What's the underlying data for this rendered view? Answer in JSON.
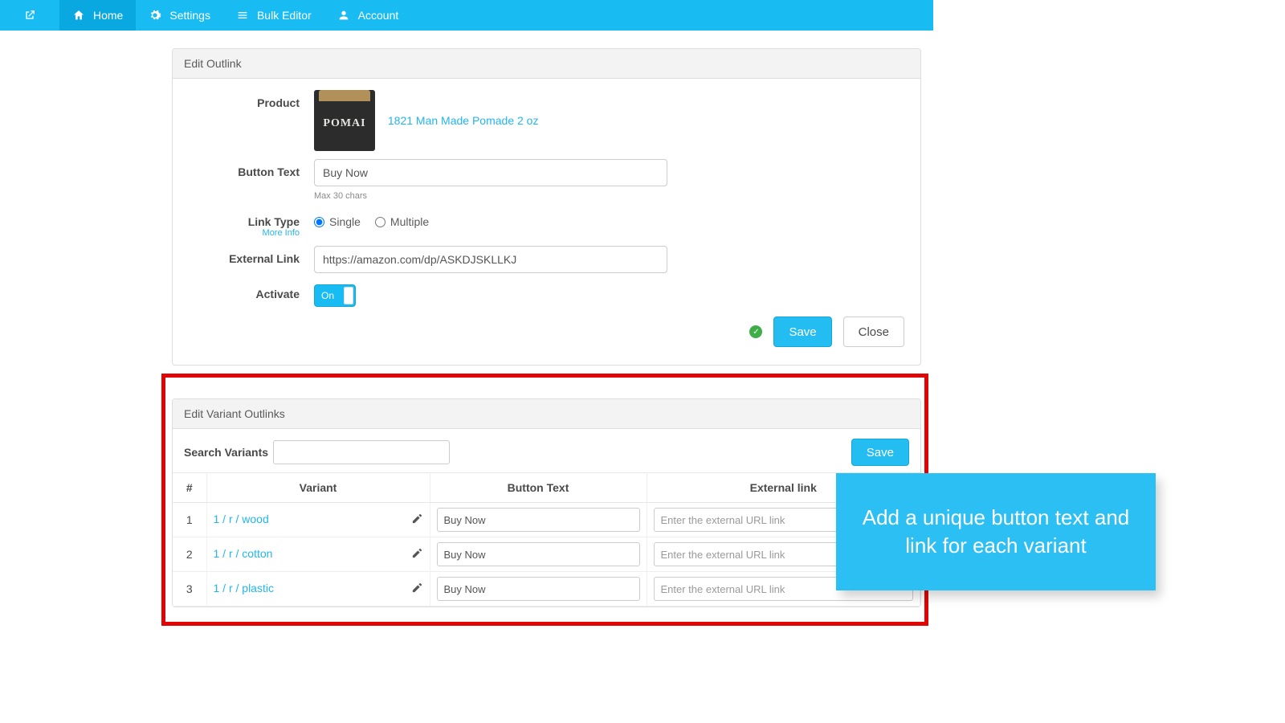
{
  "nav": {
    "home": "Home",
    "settings": "Settings",
    "bulk": "Bulk Editor",
    "account": "Account"
  },
  "panel1": {
    "title": "Edit Outlink",
    "labels": {
      "product": "Product",
      "button_text": "Button Text",
      "link_type": "Link Type",
      "external_link": "External Link",
      "activate": "Activate"
    },
    "product_name": "1821 Man Made Pomade 2 oz",
    "button_text_value": "Buy Now",
    "button_text_hint": "Max 30 chars",
    "link_type_more": "More Info",
    "link_type_single": "Single",
    "link_type_multiple": "Multiple",
    "external_link_value": "https://amazon.com/dp/ASKDJSKLLKJ",
    "activate_value": "On",
    "save": "Save",
    "close": "Close"
  },
  "panel2": {
    "title": "Edit Variant Outlinks",
    "search_label": "Search Variants",
    "save": "Save",
    "columns": {
      "num": "#",
      "variant": "Variant",
      "button_text": "Button Text",
      "external_link": "External link"
    },
    "ext_placeholder": "Enter the external URL link",
    "rows": [
      {
        "n": "1",
        "variant": "1 / r / wood",
        "button_text": "Buy Now"
      },
      {
        "n": "2",
        "variant": "1 / r / cotton",
        "button_text": "Buy Now"
      },
      {
        "n": "3",
        "variant": "1 / r / plastic",
        "button_text": "Buy Now"
      }
    ]
  },
  "callout": "Add a unique button text and link for each variant",
  "product_thumb_text": "POMAI"
}
